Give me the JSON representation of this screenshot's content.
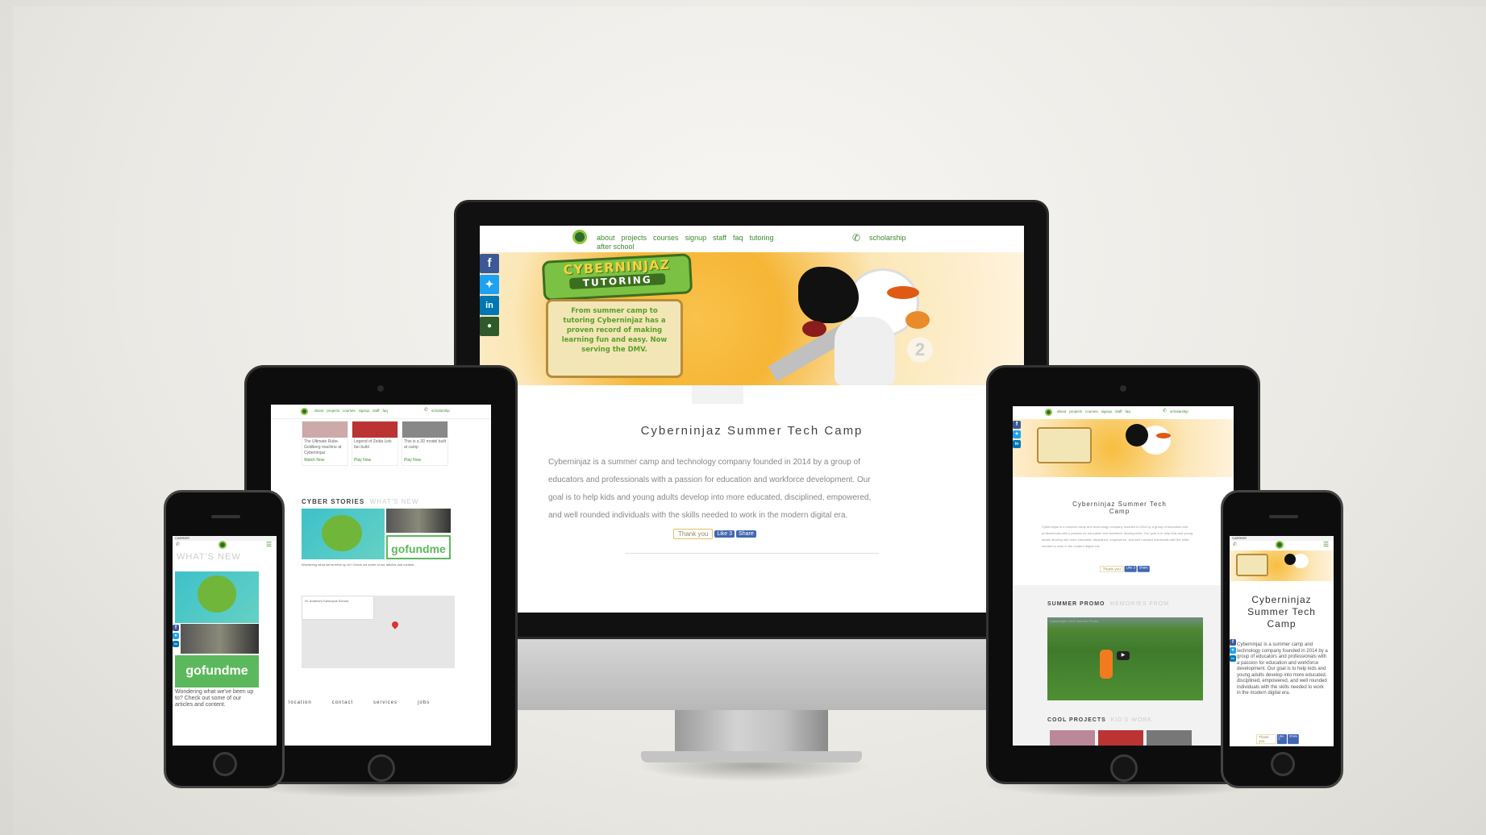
{
  "brand": {
    "accent": "#3d8b2b",
    "facebook": "#3b5998",
    "twitter": "#1da1f2",
    "linkedin": "#0077b5"
  },
  "nav": {
    "links": [
      "about",
      "projects",
      "courses",
      "signup",
      "staff",
      "faq",
      "tutoring"
    ],
    "sub_link": "after school",
    "phone_icon": "phone-icon",
    "scholarship": "scholarship"
  },
  "hero": {
    "logo_line1": "CYBERNINJAZ",
    "logo_line2": "TUTORING",
    "scroll_text": "From summer camp to tutoring Cyberninjaz has a proven record of making learning fun and easy. Now serving the DMV."
  },
  "main": {
    "title": "Cyberninjaz Summer Tech Camp",
    "description": "Cyberninjaz is a summer camp and technology company founded in 2014 by a group of educators and professionals with a passion for education and workforce development. Our goal is to help kids and young adults develop into more educated, disciplined, empowered, and well rounded individuals with the skills needed to work in the modern digital era.",
    "thank_you": "Thank you",
    "like_label": "Like 3",
    "share_label": "Share"
  },
  "ipad_left": {
    "cards": [
      {
        "text": "The Ultimate Rube-Goldberg machine at Cyberninjaz",
        "link": "Watch Now"
      },
      {
        "text": "Legend of Zelda Link fan build",
        "link": "Play Now"
      },
      {
        "text": "This is a 3D model built at camp",
        "link": "Play Now"
      }
    ],
    "cyber_stories": "CYBER STORIES",
    "whats_new_soft": "WHAT'S NEW",
    "gofundme": "gofundme",
    "wondering": "Wondering what we've been up to? Check out some of our articles and content.",
    "map_title": "St. Andrew's Episcopal School",
    "footer_heads": [
      "location",
      "contact",
      "services",
      "jobs"
    ]
  },
  "ipad_right": {
    "title": "Cyberninjaz Summer Tech Camp",
    "summer_promo": "SUMMER PROMO",
    "memories": "MEMORIES FROM",
    "video_title": "Cyberninjaz 2016 Summer Promo",
    "cool_projects": "COOL PROJECTS",
    "kids_work": "KID'S WORK"
  },
  "iphone_left": {
    "carrier": "CARRIER",
    "whats_new": "WHAT'S NEW",
    "gofundme": "gofundme",
    "wondering": "Wondering what we've been up to? Check out some of our articles and content."
  },
  "iphone_right": {
    "carrier": "CARRIER",
    "title": "Cyberninjaz Summer Tech Camp",
    "description": "Cyberninjaz is a summer camp and technology company founded in 2014 by a group of educators and professionals with a passion for education and workforce development. Our goal is to help kids and young adults develop into more educated, disciplined, empowered, and well rounded individuals with the skills needed to work in the modern digital era."
  }
}
